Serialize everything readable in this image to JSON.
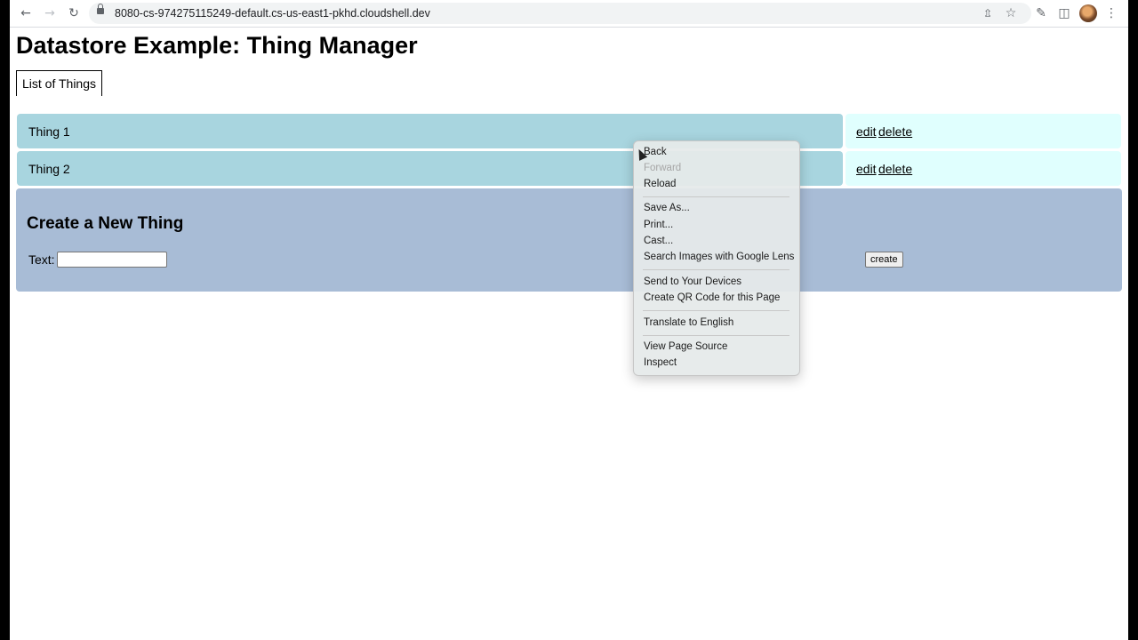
{
  "browser": {
    "url": "8080-cs-974275115249-default.cs-us-east1-pkhd.cloudshell.dev",
    "icons": [
      "back-icon",
      "forward-icon",
      "reload-icon",
      "lock-icon",
      "share-icon",
      "star-icon",
      "extensions-icon",
      "side-panel-icon",
      "avatar",
      "more-icon"
    ]
  },
  "page": {
    "title": "Datastore Example: Thing Manager",
    "tab_label": "List of Things",
    "things": [
      {
        "name": "Thing 1",
        "edit": "edit",
        "delete": "delete"
      },
      {
        "name": "Thing 2",
        "edit": "edit",
        "delete": "delete"
      }
    ],
    "create": {
      "heading": "Create a New Thing",
      "text_label": "Text:",
      "text_value": "",
      "button_label": "create"
    }
  },
  "context_menu": {
    "items": [
      {
        "label": "Back",
        "enabled": true
      },
      {
        "label": "Forward",
        "enabled": false
      },
      {
        "label": "Reload",
        "enabled": true
      },
      {
        "label": "Save As...",
        "enabled": true
      },
      {
        "label": "Print...",
        "enabled": true
      },
      {
        "label": "Cast...",
        "enabled": true
      },
      {
        "label": "Search Images with Google Lens",
        "enabled": true
      },
      {
        "label": "Send to Your Devices",
        "enabled": true
      },
      {
        "label": "Create QR Code for this Page",
        "enabled": true
      },
      {
        "label": "Translate to English",
        "enabled": true
      },
      {
        "label": "View Page Source",
        "enabled": true
      },
      {
        "label": "Inspect",
        "enabled": true
      }
    ]
  },
  "colors": {
    "thing_row": "#a8d5df",
    "actions_cell": "#e0fffe",
    "create_panel": "#a8bcd6"
  }
}
